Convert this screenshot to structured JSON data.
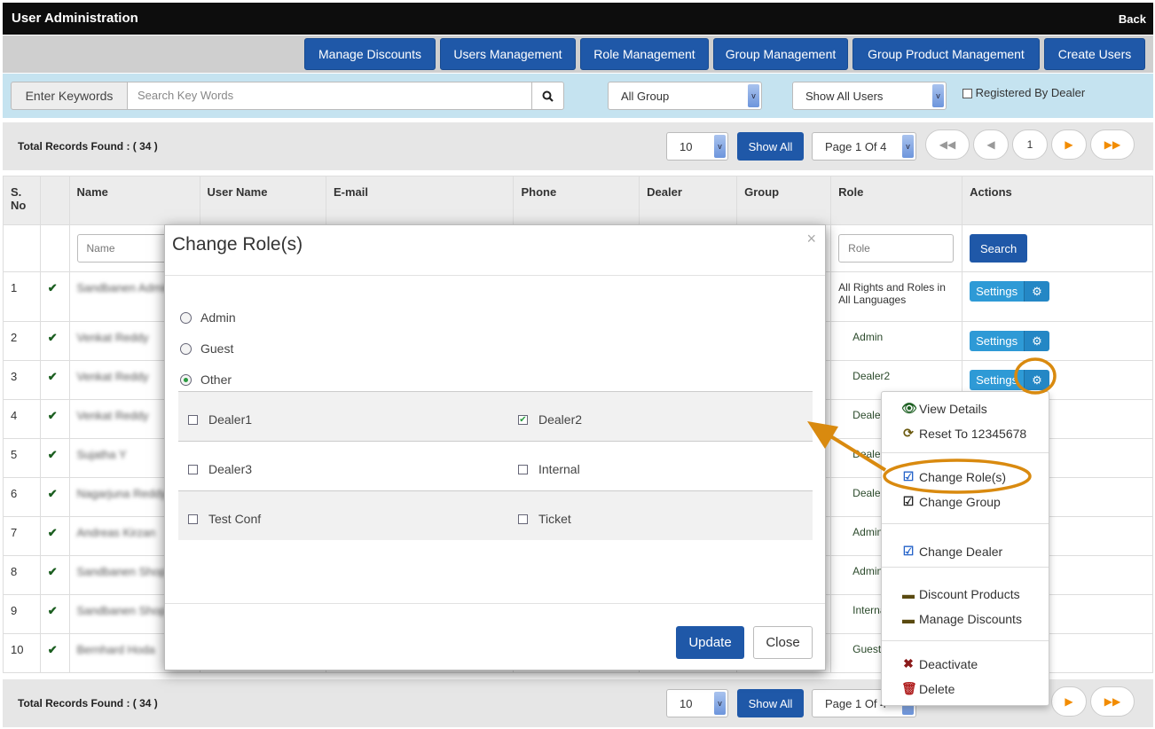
{
  "header": {
    "title": "User Administration",
    "back": "Back"
  },
  "nav": [
    "Manage Discounts",
    "Users Management",
    "Role Management",
    "Group Management",
    "Group Product Management",
    "Create Users"
  ],
  "filters": {
    "keywords_label": "Enter Keywords",
    "search_placeholder": "Search Key Words",
    "group": "All Group",
    "users": "Show All Users",
    "registered_by_dealer": "Registered By Dealer"
  },
  "pager": {
    "total": "Total Records Found : ( 34 )",
    "page_size": "10",
    "show_all": "Show All",
    "page": "Page 1 Of 4",
    "page_bottom": "Page 1 Of 4",
    "current": "1"
  },
  "table": {
    "headers": [
      "S. No",
      "",
      "Name",
      "User Name",
      "E-mail",
      "Phone",
      "Dealer",
      "Group",
      "Role",
      "Actions"
    ],
    "filter_name": "Name",
    "filter_role": "Role",
    "search": "Search",
    "settings": "Settings",
    "rows": [
      {
        "no": "1",
        "name": "Sandbanen Admin",
        "role": "All Rights and Roles in All Languages"
      },
      {
        "no": "2",
        "name": "Venkat Reddy",
        "role": "Admin"
      },
      {
        "no": "3",
        "name": "Venkat Reddy",
        "role": "Dealer2"
      },
      {
        "no": "4",
        "name": "Venkat Reddy",
        "role": "Dealer"
      },
      {
        "no": "5",
        "name": "Sujatha Y",
        "role": "Dealer"
      },
      {
        "no": "6",
        "name": "Nagarjuna Reddy",
        "role": "Dealer"
      },
      {
        "no": "7",
        "name": "Andreas Kirzan",
        "role": "Admin"
      },
      {
        "no": "8",
        "name": "Sandbanen Shop",
        "role": "Admin"
      },
      {
        "no": "9",
        "name": "Sandbanen Shop",
        "role": "Internal"
      },
      {
        "no": "10",
        "name": "Bernhard Hoda",
        "role": "Guest"
      }
    ]
  },
  "modal": {
    "title": "Change Role(s)",
    "radios": [
      {
        "label": "Admin",
        "checked": false
      },
      {
        "label": "Guest",
        "checked": false
      },
      {
        "label": "Other",
        "checked": true
      }
    ],
    "checkboxes": [
      {
        "label": "Dealer1",
        "checked": false
      },
      {
        "label": "Dealer2",
        "checked": true
      },
      {
        "label": "Dealer3",
        "checked": false
      },
      {
        "label": "Internal",
        "checked": false
      },
      {
        "label": "Test Conf",
        "checked": false
      },
      {
        "label": "Ticket",
        "checked": false
      }
    ],
    "update": "Update",
    "close": "Close"
  },
  "menu": [
    {
      "label": "View Details",
      "icon": "eye-icon"
    },
    {
      "label": "Reset To 12345678",
      "icon": "refresh-icon"
    },
    {
      "label": "Change Role(s)",
      "icon": "edit-icon"
    },
    {
      "label": "Change Group",
      "icon": "edit-icon"
    },
    {
      "label": "Change Dealer",
      "icon": "edit-icon"
    },
    {
      "label": "Discount Products",
      "icon": "minus-icon"
    },
    {
      "label": "Manage Discounts",
      "icon": "minus-icon"
    },
    {
      "label": "Deactivate",
      "icon": "x-icon"
    },
    {
      "label": "Delete",
      "icon": "trash-icon"
    }
  ],
  "colors": {
    "primary": "#1f58a8",
    "settings": "#2e9ad6",
    "annotation": "#d98a0f",
    "filter_bg": "#c5e3f0"
  }
}
